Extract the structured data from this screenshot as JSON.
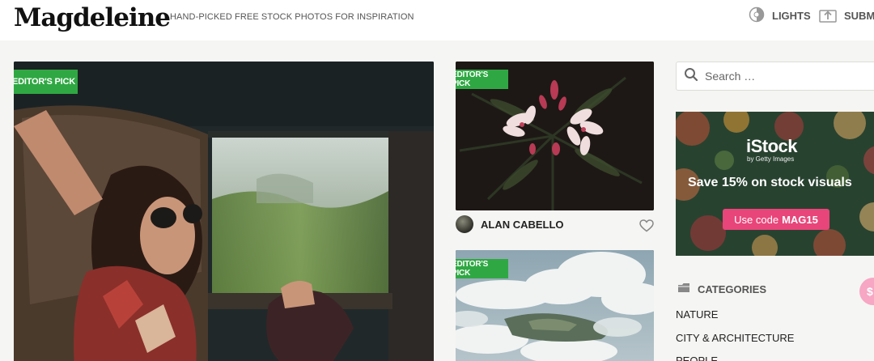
{
  "site": {
    "logo": "Magdeleine",
    "tagline": "HAND-PICKED FREE STOCK PHOTOS FOR INSPIRATION"
  },
  "nav": {
    "lights_label": "LIGHTS",
    "submit_label": "SUBMIT"
  },
  "photos": [
    {
      "badge": "EDITOR'S PICK"
    },
    {
      "badge": "EDITOR'S PICK",
      "author": "ALAN CABELLO"
    },
    {
      "badge": "EDITOR'S PICK"
    }
  ],
  "search": {
    "placeholder": "Search …"
  },
  "ad": {
    "brand": "iStock",
    "brand_sub": "by Getty Images",
    "headline": "Save 15% on stock visuals",
    "cta_prefix": "Use code",
    "cta_code": "MAG15",
    "cta_color": "#e8457a"
  },
  "categories": {
    "heading": "CATEGORIES",
    "items": [
      "NATURE",
      "CITY & ARCHITECTURE",
      "PEOPLE"
    ]
  },
  "fab": {
    "label": "$"
  },
  "colors": {
    "badge": "#2fa843",
    "page_bg": "#f5f5f3"
  }
}
